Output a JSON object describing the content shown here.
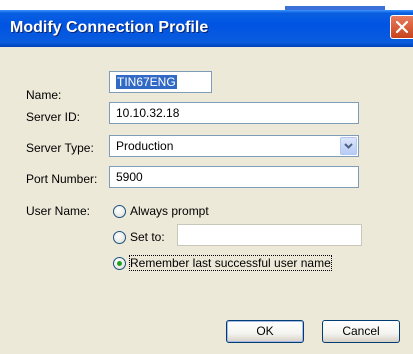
{
  "dialog": {
    "title": "Modify Connection Profile"
  },
  "form": {
    "name_label": "Name:",
    "name_value": "TIN67ENG",
    "server_id_label": "Server ID:",
    "server_id_value": "10.10.32.18",
    "server_type_label": "Server Type:",
    "server_type_value": "Production",
    "port_label": "Port Number:",
    "port_value": "5900",
    "user_name_label": "User Name:",
    "user_options": [
      {
        "label": "Always prompt",
        "selected": false
      },
      {
        "label": "Set to:",
        "selected": false
      },
      {
        "label": "Remember last successful user name",
        "selected": true
      }
    ],
    "set_to_value": ""
  },
  "buttons": {
    "ok": "OK",
    "cancel": "Cancel"
  },
  "icons": {
    "close": "close-icon",
    "dropdown": "chevron-down-icon"
  },
  "colors": {
    "titlebar": "#0054e3",
    "close_button": "#c8421b",
    "dialog_bg": "#ece9d8",
    "selection": "#316ac5",
    "radio_dot": "#21a121"
  }
}
